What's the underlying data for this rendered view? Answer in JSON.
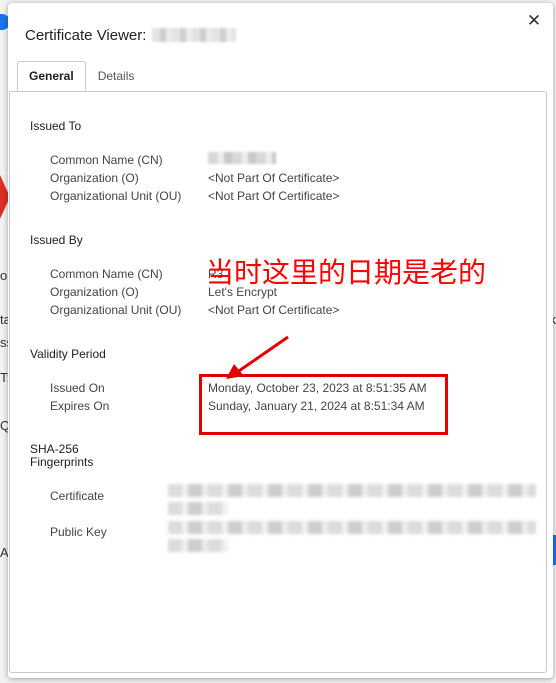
{
  "window": {
    "title": "Certificate Viewer:",
    "close_glyph": "✕"
  },
  "tabs": [
    {
      "label": "General",
      "active": true
    },
    {
      "label": "Details",
      "active": false
    }
  ],
  "issued_to": {
    "heading": "Issued To",
    "common_name_label": "Common Name (CN)",
    "organization_label": "Organization (O)",
    "organization_value": "<Not Part Of Certificate>",
    "org_unit_label": "Organizational Unit (OU)",
    "org_unit_value": "<Not Part Of Certificate>"
  },
  "issued_by": {
    "heading": "Issued By",
    "common_name_label": "Common Name (CN)",
    "common_name_value": "R3",
    "organization_label": "Organization (O)",
    "organization_value": "Let's Encrypt",
    "org_unit_label": "Organizational Unit (OU)",
    "org_unit_value": "<Not Part Of Certificate>"
  },
  "validity": {
    "heading": "Validity Period",
    "issued_on_label": "Issued On",
    "issued_on_value": "Monday, October 23, 2023 at 8:51:35 AM",
    "expires_on_label": "Expires On",
    "expires_on_value": "Sunday, January 21, 2024 at 8:51:34 AM"
  },
  "fingerprints": {
    "heading_line1": "SHA-256",
    "heading_line2": "Fingerprints",
    "certificate_label": "Certificate",
    "public_key_label": "Public Key"
  },
  "annotation": {
    "text": "当时这里的日期是老的",
    "color": "#ff0000"
  }
}
